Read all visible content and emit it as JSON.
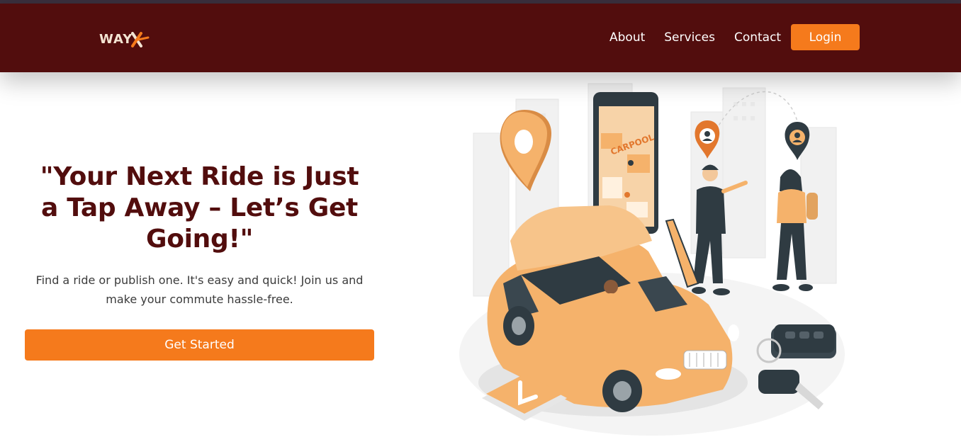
{
  "header": {
    "logo_text": "WAY",
    "nav": [
      {
        "label": "About"
      },
      {
        "label": "Services"
      },
      {
        "label": "Contact"
      }
    ],
    "login_label": "Login"
  },
  "hero": {
    "headline": "\"Your Next Ride is Just a Tap Away – Let’s Get Going!\"",
    "subtext": "Find a ride or publish one. It's easy and quick! Join us and make your commute hassle-free.",
    "cta_label": "Get Started"
  },
  "illustration": {
    "phone_sign": "CARPOOL"
  },
  "colors": {
    "header_bg": "#520d0d",
    "accent": "#f57a1c",
    "headline": "#520d0d",
    "car": "#f5b26b"
  }
}
